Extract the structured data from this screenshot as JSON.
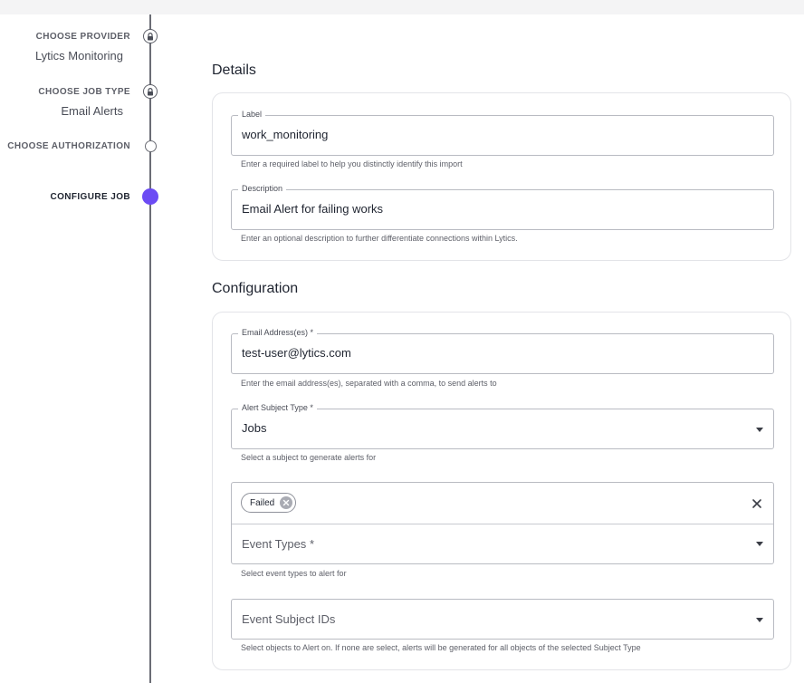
{
  "stepper": {
    "steps": [
      {
        "title": "CHOOSE PROVIDER",
        "value": "Lytics Monitoring",
        "state": "locked"
      },
      {
        "title": "CHOOSE JOB TYPE",
        "value": "Email Alerts",
        "state": "locked"
      },
      {
        "title": "CHOOSE AUTHORIZATION",
        "value": "",
        "state": "pending"
      },
      {
        "title": "CONFIGURE JOB",
        "value": "",
        "state": "active"
      }
    ],
    "active_color": "#6c4bf4"
  },
  "details": {
    "title": "Details",
    "label_field": {
      "label": "Label",
      "value": "work_monitoring",
      "helper": "Enter a required label to help you distinctly identify this import"
    },
    "description_field": {
      "label": "Description",
      "value": "Email Alert for failing works",
      "helper": "Enter an optional description to further differentiate connections within Lytics."
    }
  },
  "configuration": {
    "title": "Configuration",
    "email_field": {
      "label": "Email Address(es)",
      "required": "*",
      "value": "test-user@lytics.com",
      "helper": "Enter the email address(es), separated with a comma, to send alerts to"
    },
    "subject_type_field": {
      "label": "Alert Subject Type",
      "required": "*",
      "value": "Jobs",
      "helper": "Select a subject to generate alerts for"
    },
    "event_types": {
      "selected_tags": [
        "Failed"
      ],
      "placeholder": "Event Types",
      "required": "*",
      "helper": "Select event types to alert for"
    },
    "event_subject_ids": {
      "placeholder": "Event Subject IDs",
      "helper": "Select objects to Alert on. If none are select, alerts will be generated for all objects of the selected Subject Type"
    }
  }
}
